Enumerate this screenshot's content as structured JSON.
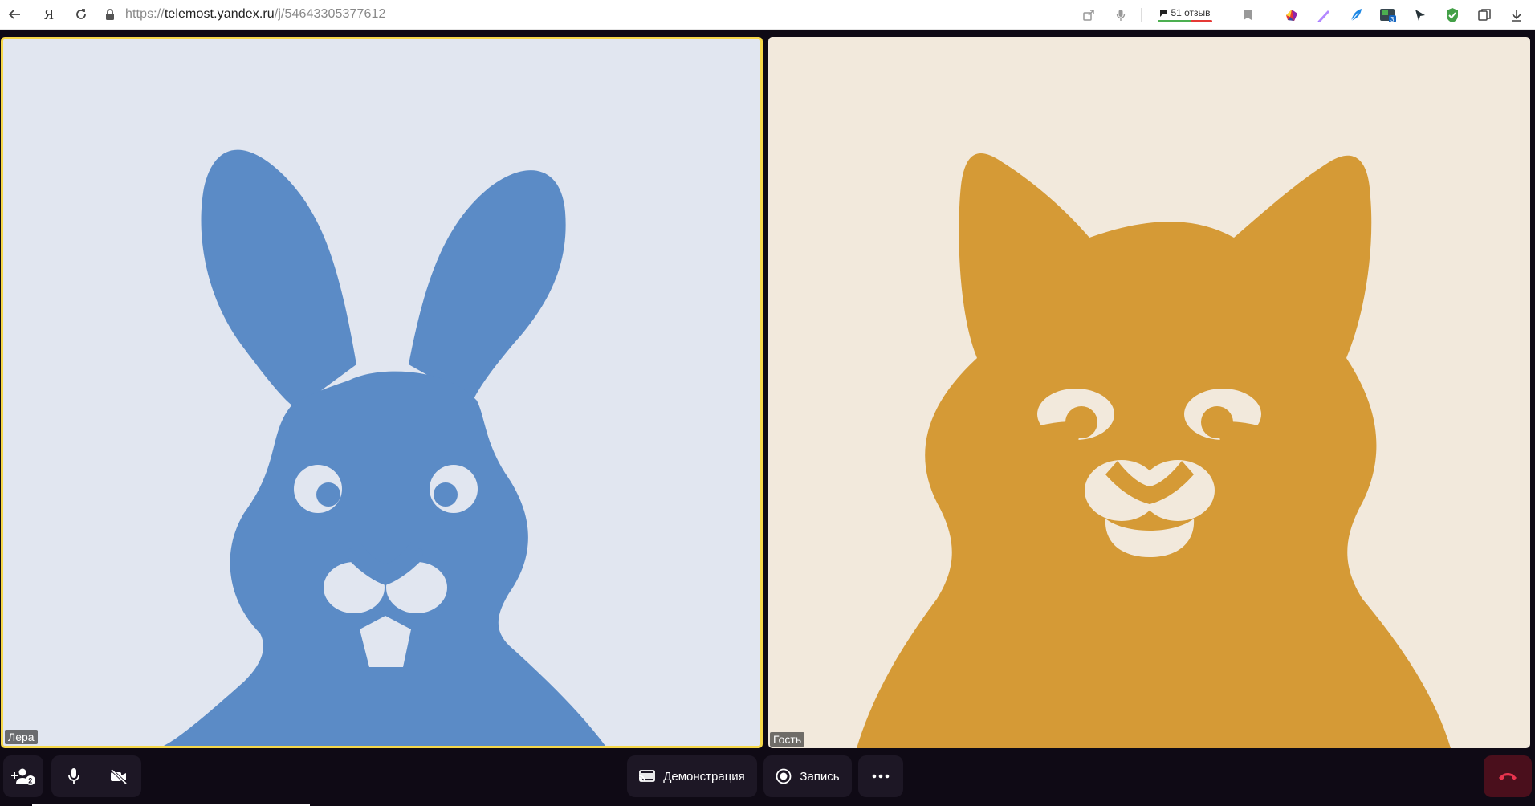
{
  "browser": {
    "url_scheme": "https://",
    "url_host": "telemost.yandex.ru",
    "url_path": "/j/54643305377612",
    "reviews_label": "51 отзыв",
    "yandex_letter": "Я"
  },
  "participants": [
    {
      "name": "Лера",
      "avatar": "rabbit-avatar",
      "bg": "#e1e6f0",
      "fg": "#5b8bc6",
      "speaking": true
    },
    {
      "name": "Гость",
      "avatar": "cat-avatar",
      "bg": "#f2e9dc",
      "fg": "#d59a36",
      "speaking": false
    }
  ],
  "toolbar": {
    "add_user_badge": "2",
    "demo_label": "Демонстрация",
    "record_label": "Запись"
  },
  "colors": {
    "stage_bg": "#0f0a15",
    "button_bg": "#1d1725",
    "active_border": "#f6d84a",
    "hangup_bg": "#4a0f1c",
    "hangup_icon": "#e8344e"
  }
}
